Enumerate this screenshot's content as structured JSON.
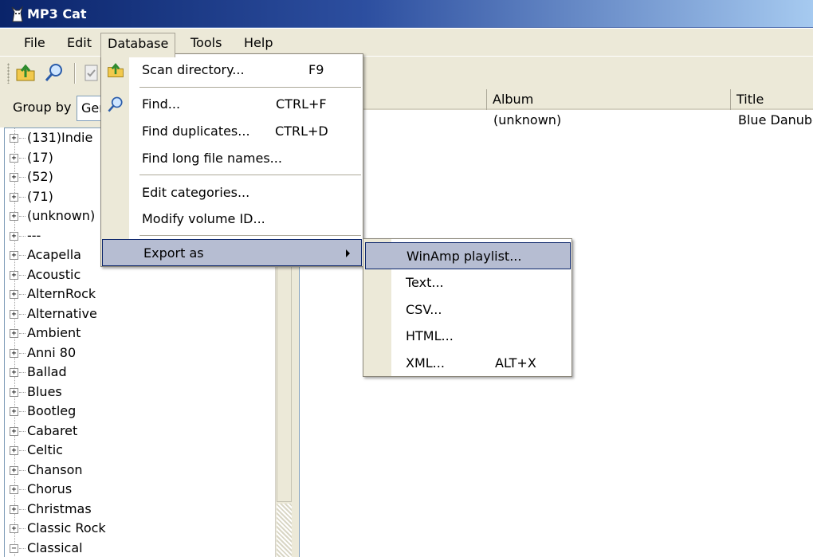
{
  "window": {
    "title": "MP3 Cat"
  },
  "menubar": [
    "File",
    "Edit",
    "Database",
    "Tools",
    "Help"
  ],
  "groupby": {
    "label": "Group by",
    "value": "Genre"
  },
  "tree": {
    "items": [
      "(131)Indie",
      "(17)",
      "(52)",
      "(71)",
      "(unknown)",
      "---",
      "Acapella",
      "Acoustic",
      "AlternRock",
      "Alternative",
      "Ambient",
      "Anni 80",
      "Ballad",
      "Blues",
      "Bootleg",
      "Cabaret",
      "Celtic",
      "Chanson",
      "Chorus",
      "Christmas",
      "Classic Rock",
      "Classical"
    ],
    "last_expanded": true
  },
  "listview": {
    "columns": [
      "",
      "Album",
      "Title"
    ],
    "rows": [
      [
        "",
        "(unknown)",
        "Blue Danube"
      ]
    ]
  },
  "database_menu": [
    {
      "label": "Scan directory...",
      "shortcut": "F9",
      "icon": "folder-up-icon"
    },
    {
      "label": "Find...",
      "shortcut": "CTRL+F",
      "icon": "magnifier-icon"
    },
    {
      "label": "Find duplicates...",
      "shortcut": "CTRL+D"
    },
    {
      "label": "Find long file names..."
    },
    {
      "label": "Edit categories..."
    },
    {
      "label": "Modify volume ID..."
    },
    {
      "label": "Export as",
      "submenu": true,
      "highlighted": true
    }
  ],
  "export_menu": [
    {
      "label": "WinAmp playlist...",
      "highlighted": true
    },
    {
      "label": "Text..."
    },
    {
      "label": "CSV..."
    },
    {
      "label": "HTML..."
    },
    {
      "label": "XML...",
      "shortcut": "ALT+X"
    }
  ],
  "colors": {
    "titlebar_start": "#0a246a",
    "titlebar_end": "#a6caf0",
    "menu_highlight": "#b6bdd2",
    "chrome": "#ece9d8"
  }
}
